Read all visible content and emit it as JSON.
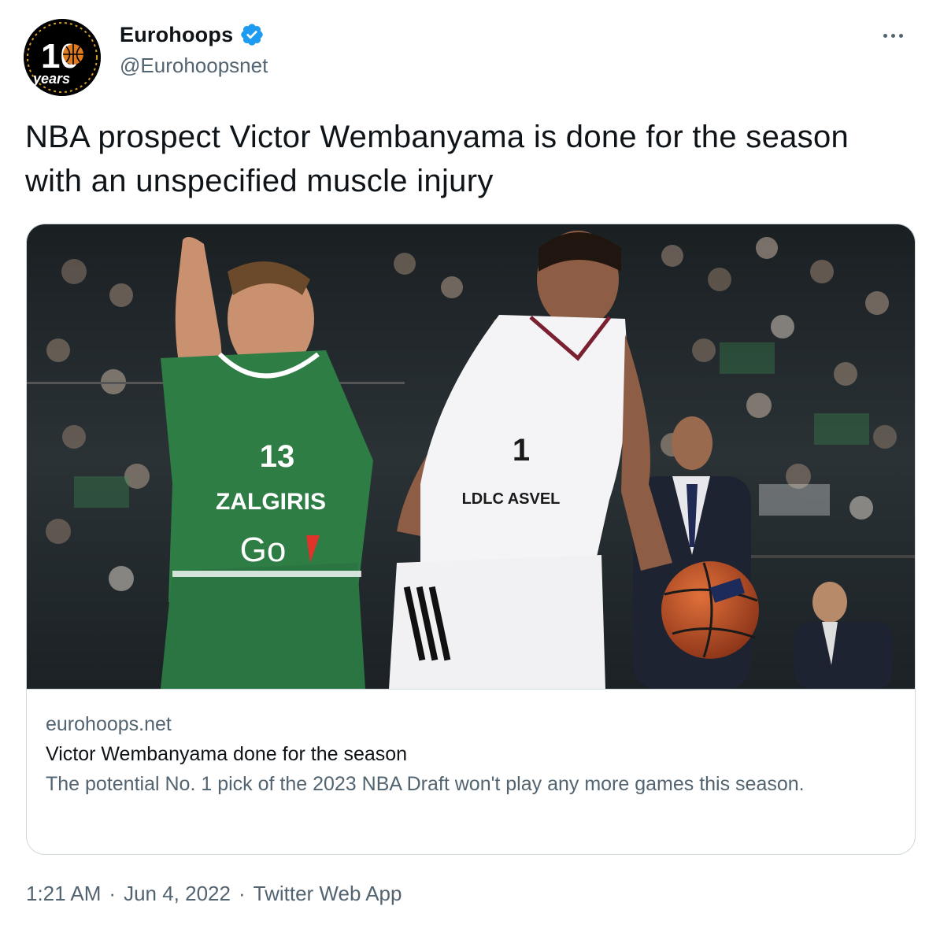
{
  "author": {
    "display_name": "Eurohoops",
    "handle": "@Eurohoopsnet",
    "avatar_icon": "eurohoops-10-years-logo",
    "avatar_text_number": "10",
    "avatar_text_word": "years",
    "verified_icon": "verified-badge-icon",
    "verified_color": "#1d9bf0"
  },
  "tweet": {
    "text": "NBA prospect Victor Wembanyama is done for the season with an unspecified muscle injury"
  },
  "card": {
    "image_icon": "basketball-game-photo",
    "jersey_left_number": "13",
    "jersey_left_team": "ZALGIRIS",
    "jersey_left_sponsor": "Go",
    "jersey_right_number": "1",
    "jersey_right_team": "LDLC ASVEL",
    "domain": "eurohoops.net",
    "title": "Victor Wembanyama done for the season",
    "description": "The potential No. 1 pick of the 2023 NBA Draft won't play any more games this season."
  },
  "meta": {
    "time": "1:21 AM",
    "separator": "·",
    "date": "Jun 4, 2022",
    "source": "Twitter Web App"
  },
  "colors": {
    "text_primary": "#0f1419",
    "text_secondary": "#536471",
    "border": "#cfd9de",
    "zalgiris_green": "#2e7d45",
    "asvel_white": "#f4f4f6"
  }
}
